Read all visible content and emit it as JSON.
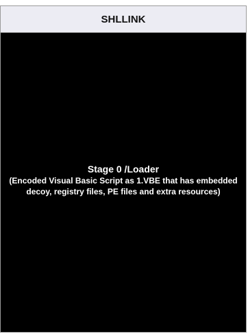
{
  "header": {
    "title": "SHLLINK"
  },
  "stage": {
    "title": "Stage 0 /Loader",
    "description": "(Encoded Visual Basic Script as 1.VBE that has embedded decoy, registry files, PE files and extra resources)"
  },
  "colors": {
    "header_bg": "#ececf3",
    "body_bg": "#000000",
    "text_light": "#ffffff",
    "border": "#9a9a9a"
  }
}
